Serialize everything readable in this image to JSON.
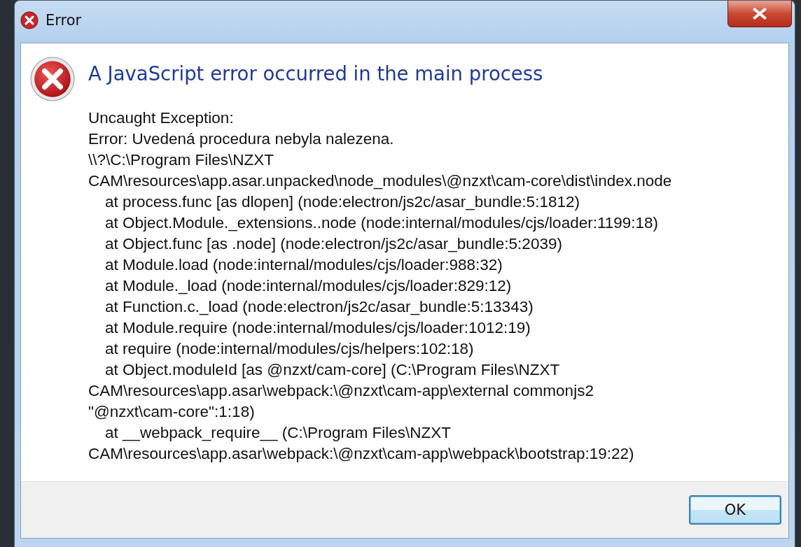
{
  "window": {
    "title": "Error"
  },
  "heading": "A JavaScript error occurred in the main process",
  "message_lines": [
    {
      "text": "Uncaught Exception:",
      "indented": false
    },
    {
      "text": "Error: Uvedená procedura nebyla nalezena.",
      "indented": false
    },
    {
      "text": "\\\\?\\C:\\Program Files\\NZXT",
      "indented": false
    },
    {
      "text": "CAM\\resources\\app.asar.unpacked\\node_modules\\@nzxt\\cam-core\\dist\\index.node",
      "indented": false
    },
    {
      "text": "at process.func [as dlopen] (node:electron/js2c/asar_bundle:5:1812)",
      "indented": true
    },
    {
      "text": "at Object.Module._extensions..node (node:internal/modules/cjs/loader:1199:18)",
      "indented": true
    },
    {
      "text": "at Object.func [as .node] (node:electron/js2c/asar_bundle:5:2039)",
      "indented": true
    },
    {
      "text": "at Module.load (node:internal/modules/cjs/loader:988:32)",
      "indented": true
    },
    {
      "text": "at Module._load (node:internal/modules/cjs/loader:829:12)",
      "indented": true
    },
    {
      "text": "at Function.c._load (node:electron/js2c/asar_bundle:5:13343)",
      "indented": true
    },
    {
      "text": "at Module.require (node:internal/modules/cjs/loader:1012:19)",
      "indented": true
    },
    {
      "text": "at require (node:internal/modules/cjs/helpers:102:18)",
      "indented": true
    },
    {
      "text": "at Object.moduleId [as @nzxt/cam-core] (C:\\Program Files\\NZXT",
      "indented": true
    },
    {
      "text": "CAM\\resources\\app.asar\\webpack:\\@nzxt\\cam-app\\external commonjs2",
      "indented": false
    },
    {
      "text": "\"@nzxt\\cam-core\":1:18)",
      "indented": false
    },
    {
      "text": "at __webpack_require__ (C:\\Program Files\\NZXT",
      "indented": true
    },
    {
      "text": "CAM\\resources\\app.asar\\webpack:\\@nzxt\\cam-app\\webpack\\bootstrap:19:22)",
      "indented": false
    }
  ],
  "buttons": [
    {
      "label": "OK",
      "selected": true
    }
  ]
}
